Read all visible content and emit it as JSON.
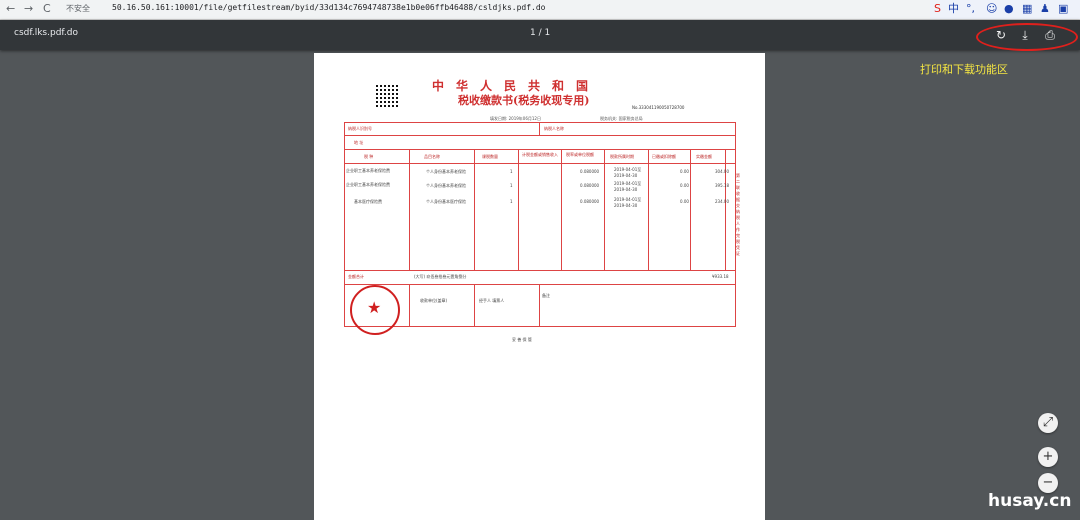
{
  "browser": {
    "security_label": "不安全",
    "url": "50.16.50.161:10001/file/getfilestream/byid/33d134c7694748738e1b0e06ffb46488/csldjks.pdf.do",
    "ime_label": "中"
  },
  "viewer": {
    "file_name": "csdf.lks.pdf.do",
    "page_indicator": "1 / 1"
  },
  "annotation": {
    "label": "打印和下载功能区",
    "color": "#f5e642"
  },
  "document": {
    "title": "中华人民共和国",
    "subtitle": "税收缴款书(税务收现专用)",
    "number": "No.333041190050728700",
    "fill_date": "填发日期: 2019年06月12日",
    "tax_office": "税务机关: 国家税务总局",
    "taxpayer_label": "纳税人识别号",
    "taxpayer_name_label": "纳税人名称",
    "address_label": "地  址",
    "columns": [
      "税  种",
      "品目名称",
      "课税数量",
      "计税金额或销售收入",
      "税率或单位税额",
      "税款所属时期",
      "已缴或扣除额",
      "实缴金额"
    ],
    "rows": [
      {
        "tax": "企业职工基本养老保险费",
        "item": "个人身份基本养老保险",
        "qty": "1",
        "rate": "0.080000",
        "period": "2019-04-01至2019-04-30",
        "paid": "0.00",
        "amount": "304.00"
      },
      {
        "tax": "企业职工基本养老保险费",
        "item": "个人身份基本养老保险",
        "qty": "1",
        "rate": "0.080000",
        "period": "2019-04-01至2019-04-30",
        "paid": "0.00",
        "amount": "395.18"
      },
      {
        "tax": "基本医疗保险费",
        "item": "个人身份基本医疗保险",
        "qty": "1",
        "rate": "0.080000",
        "period": "2019-04-01至2019-04-30",
        "paid": "0.00",
        "amount": "234.00"
      }
    ],
    "total_label": "金额合计",
    "total_words": "(大写) 玖佰叁拾叁元壹角捌分",
    "total_amount": "¥933.18",
    "side_note": "第二联 收据 交纳税人作完税凭证",
    "sign_tax_office": "税务机关(盖章)",
    "sign_agent": "收款单位(盖章)",
    "sign_collector": "经手人 填票人",
    "remark_label": "备注",
    "footer": "妥 善 保 管"
  },
  "watermark": "husay.cn"
}
